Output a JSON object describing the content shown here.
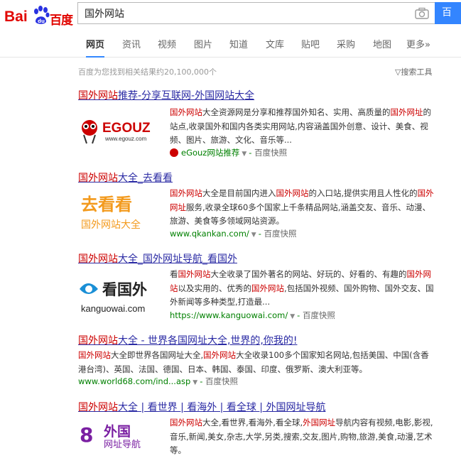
{
  "header": {
    "logo_text_left": "Bai",
    "logo_text_mid": "du",
    "logo_text_right": "百度",
    "search_value": "国外网站",
    "search_button": "百"
  },
  "tabs": [
    {
      "label": "网页"
    },
    {
      "label": "资讯"
    },
    {
      "label": "视频"
    },
    {
      "label": "图片"
    },
    {
      "label": "知道"
    },
    {
      "label": "文库"
    },
    {
      "label": "贴吧"
    },
    {
      "label": "采购"
    },
    {
      "label": "地图"
    },
    {
      "label": "更多»"
    }
  ],
  "results_info": {
    "count_text": "百度为您找到相关结果约20,100,000个",
    "tools_text": "▽搜索工具"
  },
  "results": [
    {
      "title_pre": "",
      "title_em": "国外网站",
      "title_post": "推荐-分享互联网-外国网站大全",
      "thumb_text": "EGOUZ",
      "thumb_sub": "www.egouz.com",
      "desc_html": "<em>国外网站</em>大全资源网是分享和推荐国外知名、实用、高质量的<em>国外网址</em>的站点,收录国外和国内各类实用网站,内容涵盖国外创意、设计、美食、视频、图片、旅游、文化、音乐等...",
      "url": "eGouz网站推荐",
      "snap": "百度快照"
    },
    {
      "title_em": "国外网站",
      "title_post": "大全_去看看",
      "thumb_text": "去看看",
      "thumb_sub": "国外网站大全",
      "desc_html": "<em>国外网站</em>大全是目前国内进入<em>国外网站</em>的入口站,提供实用且人性化的<em>国外网址</em>服务,收录全球60多个国家上千条精品网站,涵盖交友、音乐、动漫、旅游、美食等多领域网站资源。",
      "url": "www.qkankan.com/",
      "snap": "百度快照"
    },
    {
      "title_em": "国外网站",
      "title_post": "大全_国外网址导航_看国外",
      "thumb_text": "看国外",
      "thumb_sub": "kanguowai.com",
      "desc_html": "看<em>国外网站</em>大全收录了国外著名的网站、好玩的、好看的、有趣的<em>国外网站</em>以及实用的、优秀的<em>国外网站</em>,包括国外视频、国外购物、国外交友、国外新闻等多种类型,打造最...",
      "url": "https://www.kanguowai.com/",
      "snap": "百度快照"
    },
    {
      "title_em": "国外网站",
      "title_post": "大全 - 世界各国网址大全,世界的,你我的!",
      "desc_html": "<em>国外网站</em>大全即世界各国网址大全,<em>国外网站</em>大全收录100多个国家知名网站,包括美国、中国(含香港台湾)、英国、法国、德国、日本、韩国、泰国、印度、俄罗斯、澳大利亚等。",
      "url": "www.world68.com/ind...asp",
      "snap": "百度快照"
    },
    {
      "title_em": "国外网站",
      "title_post": "大全 | 看世界 | 看海外 | 看全球 | 外国网址导航",
      "thumb_text": "外国",
      "thumb_sub": "网址导航",
      "desc_html": "<em>国外网站</em>大全,看世界,看海外,看全球,<em>外国网址</em>导航内容有视频,电影,影视,音乐,新闻,美女,杂志,大学,另类,搜索,交友,图片,购物,旅游,美食,动漫,艺术等。"
    }
  ],
  "colors": {
    "accent": "#3385ff",
    "brand_red": "#e10601",
    "link": "#2a2aa4",
    "highlight": "#c00",
    "url_green": "#008000"
  }
}
